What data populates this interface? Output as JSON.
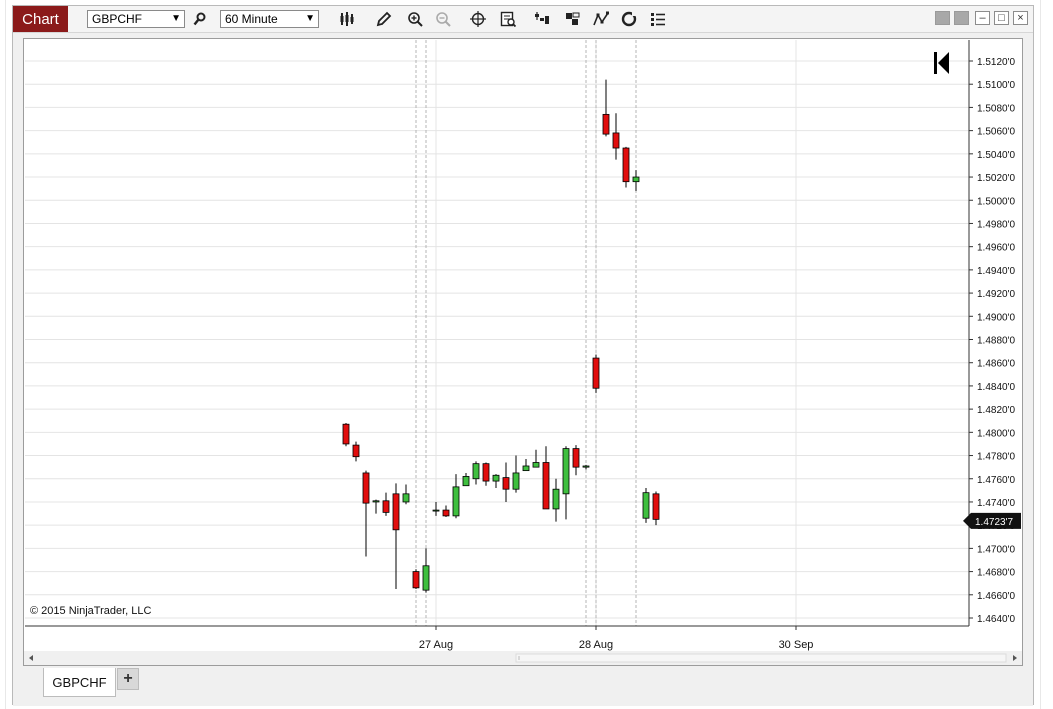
{
  "app": {
    "badge": "Chart",
    "instrument": "GBPCHF",
    "interval": "60 Minute"
  },
  "toolbar": {
    "icons": [
      "bar-type-icon",
      "draw-pencil-icon",
      "zoom-in-icon",
      "zoom-out-icon",
      "crosshair-icon",
      "data-box-icon",
      "chart-style-icon",
      "templates-icon",
      "indicators-icon",
      "strategies-icon",
      "properties-icon"
    ]
  },
  "window_controls": {
    "close": "×",
    "maximize": "□",
    "minimize": "–"
  },
  "chart": {
    "copyright": "© 2015 NinjaTrader, LLC",
    "last_price_label": "1.4723'7",
    "jump_to_end_icon": "jump-to-end-icon"
  },
  "tabs": {
    "active": "GBPCHF",
    "add": "+"
  },
  "chart_data": {
    "type": "candlestick",
    "instrument": "GBPCHF",
    "interval": "60 Minute",
    "ylim": [
      1.4635,
      1.5133
    ],
    "y_tick_labels": [
      "1.5120'0",
      "1.5100'0",
      "1.5080'0",
      "1.5060'0",
      "1.5040'0",
      "1.5020'0",
      "1.5000'0",
      "1.4980'0",
      "1.4960'0",
      "1.4940'0",
      "1.4920'0",
      "1.4900'0",
      "1.4880'0",
      "1.4860'0",
      "1.4840'0",
      "1.4820'0",
      "1.4800'0",
      "1.4780'0",
      "1.4760'0",
      "1.4740'0",
      "1.4720'0",
      "1.4700'0",
      "1.4680'0",
      "1.4660'0",
      "1.4640'0"
    ],
    "y_tick_values": [
      1.512,
      1.51,
      1.508,
      1.506,
      1.504,
      1.502,
      1.5,
      1.498,
      1.496,
      1.494,
      1.492,
      1.49,
      1.488,
      1.486,
      1.484,
      1.482,
      1.48,
      1.478,
      1.476,
      1.474,
      1.472,
      1.47,
      1.468,
      1.466,
      1.464
    ],
    "x_tick_labels": [
      "27 Aug",
      "28 Aug",
      "30 Sep"
    ],
    "last_price": 1.47237,
    "grid": true,
    "candles": [
      {
        "o": 1.4807,
        "h": 1.4808,
        "l": 1.4788,
        "c": 1.479
      },
      {
        "o": 1.4789,
        "h": 1.4792,
        "l": 1.4775,
        "c": 1.4779
      },
      {
        "o": 1.4765,
        "h": 1.4767,
        "l": 1.4693,
        "c": 1.4739
      },
      {
        "o": 1.474,
        "h": 1.4742,
        "l": 1.473,
        "c": 1.4741
      },
      {
        "o": 1.4741,
        "h": 1.4748,
        "l": 1.4728,
        "c": 1.4731
      },
      {
        "o": 1.4747,
        "h": 1.4756,
        "l": 1.4665,
        "c": 1.4716
      },
      {
        "o": 1.474,
        "h": 1.4755,
        "l": 1.4738,
        "c": 1.4747
      },
      {
        "o": 1.468,
        "h": 1.4682,
        "l": 1.4665,
        "c": 1.4666
      },
      {
        "o": 1.4664,
        "h": 1.47,
        "l": 1.4662,
        "c": 1.4685
      },
      {
        "o": 1.4733,
        "h": 1.474,
        "l": 1.4728,
        "c": 1.4733
      },
      {
        "o": 1.4733,
        "h": 1.4737,
        "l": 1.4727,
        "c": 1.4728
      },
      {
        "o": 1.4728,
        "h": 1.4764,
        "l": 1.4726,
        "c": 1.4753
      },
      {
        "o": 1.4754,
        "h": 1.4765,
        "l": 1.4754,
        "c": 1.4762
      },
      {
        "o": 1.476,
        "h": 1.4775,
        "l": 1.4755,
        "c": 1.4773
      },
      {
        "o": 1.4773,
        "h": 1.4774,
        "l": 1.4754,
        "c": 1.4758
      },
      {
        "o": 1.4758,
        "h": 1.4764,
        "l": 1.4752,
        "c": 1.4763
      },
      {
        "o": 1.4761,
        "h": 1.4774,
        "l": 1.474,
        "c": 1.4751
      },
      {
        "o": 1.4751,
        "h": 1.478,
        "l": 1.4748,
        "c": 1.4765
      },
      {
        "o": 1.4767,
        "h": 1.4777,
        "l": 1.4767,
        "c": 1.4771
      },
      {
        "o": 1.477,
        "h": 1.4785,
        "l": 1.477,
        "c": 1.4774
      },
      {
        "o": 1.4774,
        "h": 1.4788,
        "l": 1.4734,
        "c": 1.4734
      },
      {
        "o": 1.4734,
        "h": 1.476,
        "l": 1.4723,
        "c": 1.4751
      },
      {
        "o": 1.4747,
        "h": 1.4788,
        "l": 1.4725,
        "c": 1.4786
      },
      {
        "o": 1.4786,
        "h": 1.4789,
        "l": 1.4763,
        "c": 1.477
      },
      {
        "o": 1.477,
        "h": 1.4772,
        "l": 1.4768,
        "c": 1.4771
      },
      {
        "o": 1.4864,
        "h": 1.4867,
        "l": 1.4834,
        "c": 1.4838
      },
      {
        "o": 1.5074,
        "h": 1.5104,
        "l": 1.5055,
        "c": 1.5057
      },
      {
        "o": 1.5058,
        "h": 1.5075,
        "l": 1.5035,
        "c": 1.5045
      },
      {
        "o": 1.5045,
        "h": 1.5046,
        "l": 1.5011,
        "c": 1.5016
      },
      {
        "o": 1.5016,
        "h": 1.5026,
        "l": 1.5008,
        "c": 1.502
      },
      {
        "o": 1.4726,
        "h": 1.4752,
        "l": 1.4722,
        "c": 1.4748
      },
      {
        "o": 1.4747,
        "h": 1.4749,
        "l": 1.472,
        "c": 1.4725
      }
    ]
  }
}
